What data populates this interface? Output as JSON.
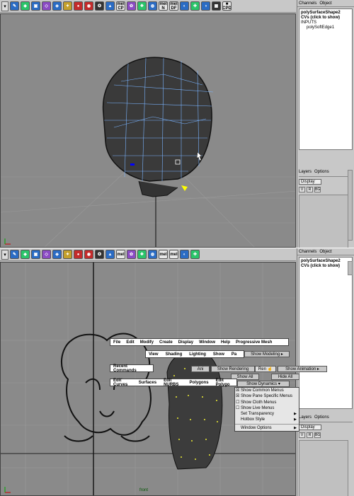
{
  "top_panel": {
    "shelf_icons": [
      "mel-icon-1",
      "mel-icon-2",
      "mel-icon-3"
    ],
    "shelf_text_icons": [
      {
        "top": "mel",
        "bottom": "CP"
      },
      {
        "top": "mel",
        "bottom": "N"
      },
      {
        "top": "mel",
        "bottom": "DF"
      },
      {
        "top": "",
        "bottom": "CPD"
      }
    ],
    "channel_box": {
      "tab_channels": "Channels",
      "tab_object": "Object",
      "shape_name": "polySurfaceShape2",
      "cvs": "CVs (click to show)",
      "inputs_label": "INPUTS",
      "input_node": "polySoftEdge1"
    },
    "layers": {
      "tab_layers": "Layers",
      "tab_options": "Options",
      "display_value": "Display",
      "buttons": [
        "V",
        "R",
        "BG"
      ]
    }
  },
  "bottom_panel": {
    "shelf_text_icons": [
      {
        "top": "mel",
        "bottom": ""
      },
      {
        "top": "mel",
        "bottom": ""
      },
      {
        "top": "mel",
        "bottom": ""
      }
    ],
    "channel_box": {
      "tab_channels": "Channels",
      "tab_object": "Object",
      "shape_name": "polySurfaceShape2",
      "cvs": "CVs (click to show)"
    },
    "layers": {
      "tab_layers": "Layers",
      "tab_options": "Options",
      "display_value": "Display",
      "buttons": [
        "V",
        "R",
        "BG"
      ]
    },
    "viewport_label": "front",
    "hotbox": {
      "main_menus": [
        "File",
        "Edit",
        "Modify",
        "Create",
        "Display",
        "Window",
        "Help",
        "Progressive Mesh"
      ],
      "view_menus": [
        "View",
        "Shading",
        "Lighting",
        "Show",
        "Pa"
      ],
      "show_modeling": "Show Modeling",
      "recent_commands": "Recent Commands",
      "show_rendering": "Show Rendering",
      "show_animation": "Show Animation",
      "show_all": "Show All",
      "hide_all": "Hide All",
      "show_dynamics": "Show Dynamics",
      "modeling_menus": [
        "Edit Curves",
        "Surfaces",
        "Edit NURBS",
        "Polygons",
        "Edit Polygo"
      ],
      "pointer_hint": "Ren",
      "ani_hint": "Ani"
    },
    "popup_menu": [
      {
        "label": "Show Common Menus",
        "state": "checked"
      },
      {
        "label": "Show Pane Specific Menus",
        "state": "checked"
      },
      {
        "label": "Show Cloth Menus",
        "state": "unchecked"
      },
      {
        "label": "Show Live Menus",
        "state": "unchecked"
      },
      {
        "label": "Set Transparency",
        "state": "sub"
      },
      {
        "label": "Hotbox Style",
        "state": "sub"
      },
      {
        "label": "Window Options",
        "state": "sub"
      }
    ]
  }
}
